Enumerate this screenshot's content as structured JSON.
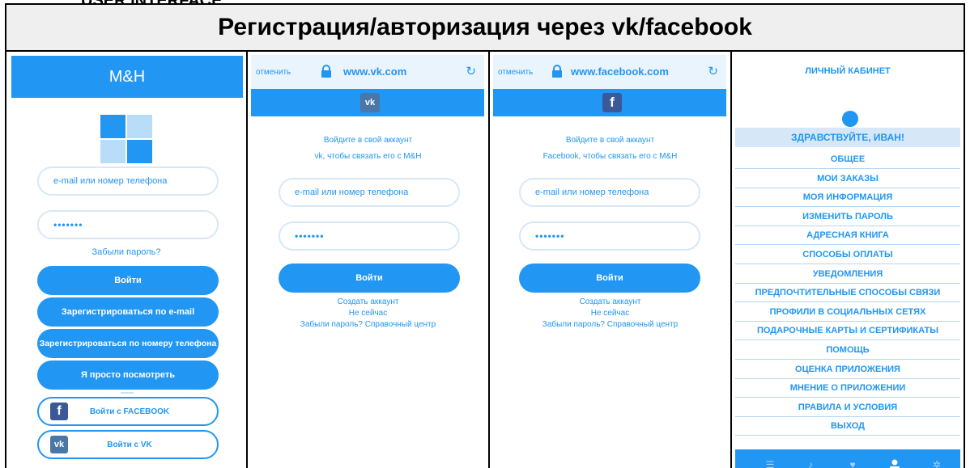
{
  "top_cut_text": "USER INTERFACE",
  "header_title": "Регистрация/авторизация через vk/facebook",
  "panel1": {
    "app_title": "M&H",
    "login_placeholder": "e-mail или номер телефона",
    "password_mask": "•••••••",
    "forgot_link": "Забыли пароль?",
    "login_button": "Войти",
    "register_email_button": "Зарегистрироваться по e-mail",
    "register_phone_button": "Зарегистрироваться по номеру телефона",
    "guest_button": "Я просто посмотреть",
    "facebook_button": "Войти с FACEBOOK",
    "vk_button": "Войти с VK",
    "facebook_icon": "f",
    "vk_icon": "vk"
  },
  "panel2": {
    "cancel": "отменить",
    "url": "www.vk.com",
    "brand_icon": "vk",
    "prompt_line1": "Войдите в свой аккаунт",
    "prompt_line2": "vk, чтобы связать его с M&H",
    "login_placeholder": "e-mail или номер телефона",
    "password_mask": "•••••••",
    "login_button": "Войти",
    "create_account": "Создать аккаунт",
    "not_now": "Не сейчас",
    "forgot_help": "Забыли пароль? Справочный центр"
  },
  "panel3": {
    "cancel": "отменить",
    "url": "www.facebook.com",
    "brand_icon": "f",
    "prompt_line1": "Войдите в свой аккаунт",
    "prompt_line2": "Facebook, чтобы связать его с M&H",
    "login_placeholder": "e-mail или номер телефона",
    "password_mask": "•••••••",
    "login_button": "Войти",
    "create_account": "Создать аккаунт",
    "not_now": "Не сейчас",
    "forgot_help": "Забыли пароль? Справочный центр"
  },
  "panel4": {
    "title": "ЛИЧНЫЙ КАБИНЕТ",
    "greeting": "ЗДРАВСТВУЙТЕ, ИВАН!",
    "menu": [
      "ОБЩЕЕ",
      "МОИ ЗАКАЗЫ",
      "МОЯ ИНФОРМАЦИЯ",
      "ИЗМЕНИТЬ ПАРОЛЬ",
      "АДРЕСНАЯ КНИГА",
      "СПОСОБЫ ОПЛАТЫ",
      "УВЕДОМЛЕНИЯ",
      "ПРЕДПОЧТИТЕЛЬНЫЕ СПОСОБЫ СВЯЗИ",
      "ПРОФИЛИ В СОЦИАЛЬНЫХ СЕТЯХ",
      "ПОДАРОЧНЫЕ КАРТЫ И СЕРТИФИКАТЫ",
      "ПОМОЩЬ",
      "ОЦЕНКА ПРИЛОЖЕНИЯ",
      "МНЕНИЕ О ПРИЛОЖЕНИИ",
      "ПРАВИЛА И УСЛОВИЯ",
      "ВЫХОД"
    ],
    "tabs": [
      "list-icon",
      "bell-icon",
      "heart-icon",
      "user-icon",
      "gear-icon"
    ]
  },
  "colors": {
    "accent": "#2196f3",
    "accent_light": "#d6e8f8",
    "facebook": "#3b5998",
    "vk": "#4a76a8"
  }
}
